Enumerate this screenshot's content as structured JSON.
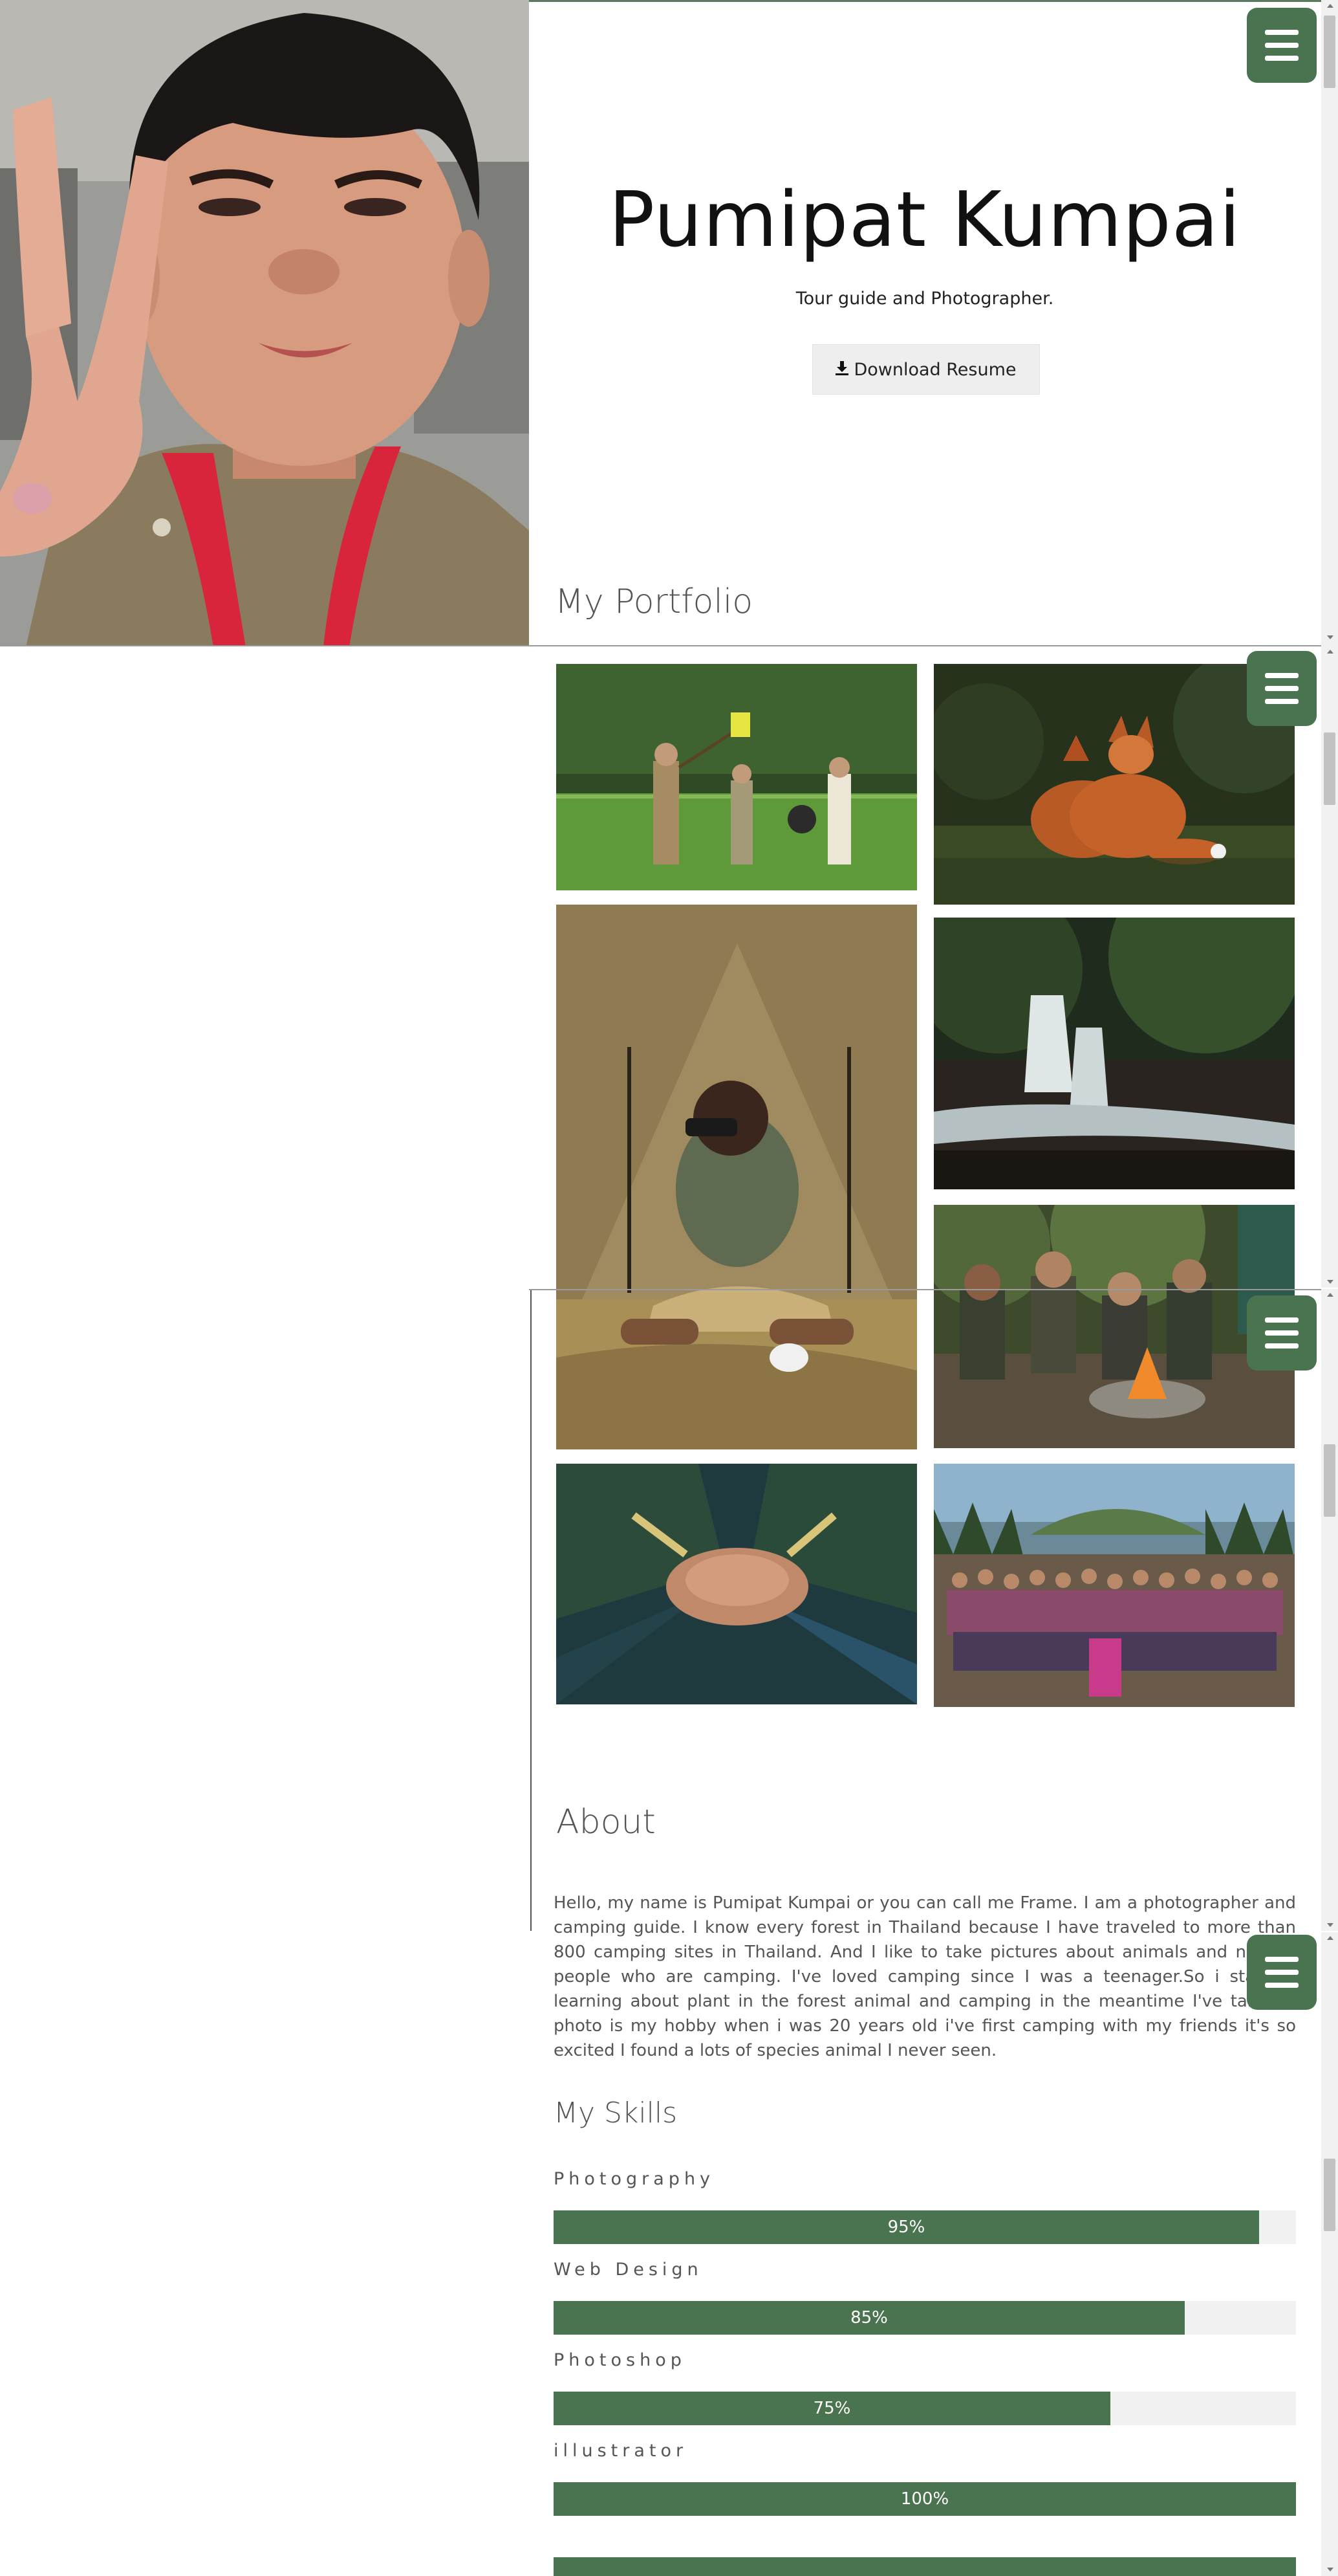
{
  "hero": {
    "name": "Pumipat Kumpai",
    "subtitle": "Tour guide and Photographer.",
    "resume_button": "Download Resume",
    "download_icon": "download-icon"
  },
  "portfolio": {
    "title": "My Portfolio",
    "photos": [
      "scouts-in-rice-field",
      "two-red-foxes",
      "boy-with-binoculars-at-tent",
      "forest-waterfall",
      "kids-at-campfire",
      "stacked-hands",
      "large-camp-group"
    ]
  },
  "about": {
    "title": "About",
    "text": "Hello, my name is Pumipat Kumpai or you can call me Frame. I am a photographer and camping guide. I know every forest in Thailand because I have traveled to more than 800 camping sites in Thailand. And I like to take pictures about animals and nature. people who are camping. I've loved camping since I was a teenager.So i start to learning about plant in the forest animal and camping in the meantime I've taken a photo is my hobby when i was 20 years old i've first camping with my friends it's so excited I found a lots of species animal I never seen.",
    "overlay_fragment": "camping guide. I know every forest in Thailand because I have traveled to more than 800"
  },
  "skills": {
    "title": "My Skills",
    "items": [
      {
        "label": "Photography",
        "percent_text": "95%",
        "value": 0.95
      },
      {
        "label": "Web Design",
        "percent_text": "85%",
        "value": 0.85
      },
      {
        "label": "Photoshop",
        "percent_text": "75%",
        "value": 0.75
      },
      {
        "label": "illustrator",
        "percent_text": "100%",
        "value": 1.0
      }
    ]
  },
  "menu_icon": "hamburger-menu-icon",
  "colors": {
    "accent": "#4a7350",
    "bar_track": "#f1f1f1",
    "button_bg": "#eeeeee"
  }
}
